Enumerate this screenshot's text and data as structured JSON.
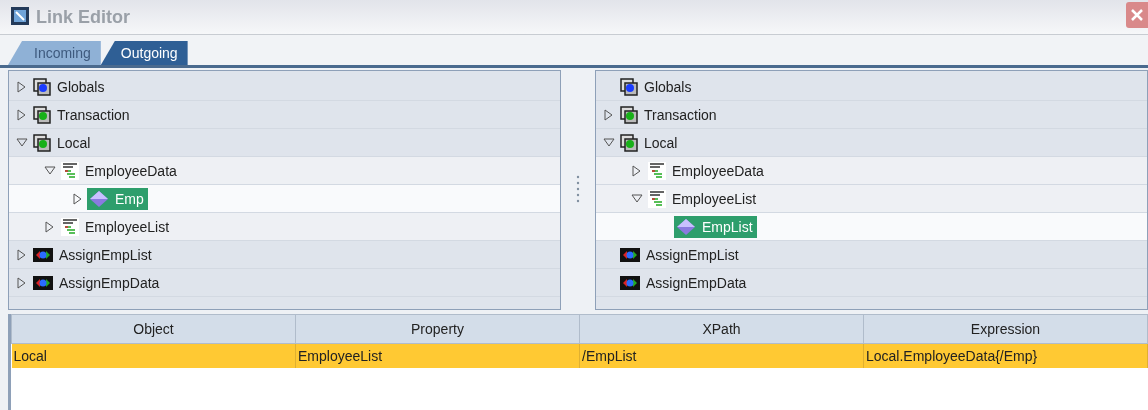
{
  "window": {
    "title": "Link Editor"
  },
  "tabs": [
    {
      "label": "Incoming",
      "selected": false
    },
    {
      "label": "Outgoing",
      "selected": true
    }
  ],
  "left_tree": [
    {
      "label": "Globals",
      "kind": "globals",
      "expanded": false,
      "selected": false
    },
    {
      "label": "Transaction",
      "kind": "transaction",
      "expanded": false,
      "selected": false
    },
    {
      "label": "Local",
      "kind": "local",
      "expanded": true,
      "selected": false,
      "children": [
        {
          "label": "EmployeeData",
          "kind": "xml",
          "expanded": true,
          "selected": false,
          "children": [
            {
              "label": "Emp",
              "kind": "element",
              "expanded": false,
              "selected": true
            }
          ]
        },
        {
          "label": "EmployeeList",
          "kind": "xml",
          "expanded": false,
          "selected": false
        }
      ]
    },
    {
      "label": "AssignEmpList",
      "kind": "action",
      "expanded": false,
      "selected": false
    },
    {
      "label": "AssignEmpData",
      "kind": "action",
      "expanded": false,
      "selected": false
    }
  ],
  "right_tree": [
    {
      "label": "Globals",
      "kind": "globals",
      "selected": false
    },
    {
      "label": "Transaction",
      "kind": "transaction",
      "expanded": false,
      "selected": false
    },
    {
      "label": "Local",
      "kind": "local",
      "expanded": true,
      "selected": false,
      "children": [
        {
          "label": "EmployeeData",
          "kind": "xml",
          "expanded": false,
          "selected": false
        },
        {
          "label": "EmployeeList",
          "kind": "xml",
          "expanded": true,
          "selected": false,
          "children": [
            {
              "label": "EmpList",
              "kind": "element",
              "selected": true
            }
          ]
        }
      ]
    },
    {
      "label": "AssignEmpList",
      "kind": "action",
      "selected": false
    },
    {
      "label": "AssignEmpData",
      "kind": "action",
      "selected": false
    }
  ],
  "table": {
    "columns": [
      "Object",
      "Property",
      "XPath",
      "Expression"
    ],
    "rows": [
      {
        "cells": [
          "Local",
          "EmployeeList",
          "/EmpList",
          "Local.EmployeeData{/Emp}"
        ],
        "selected": true
      }
    ]
  }
}
